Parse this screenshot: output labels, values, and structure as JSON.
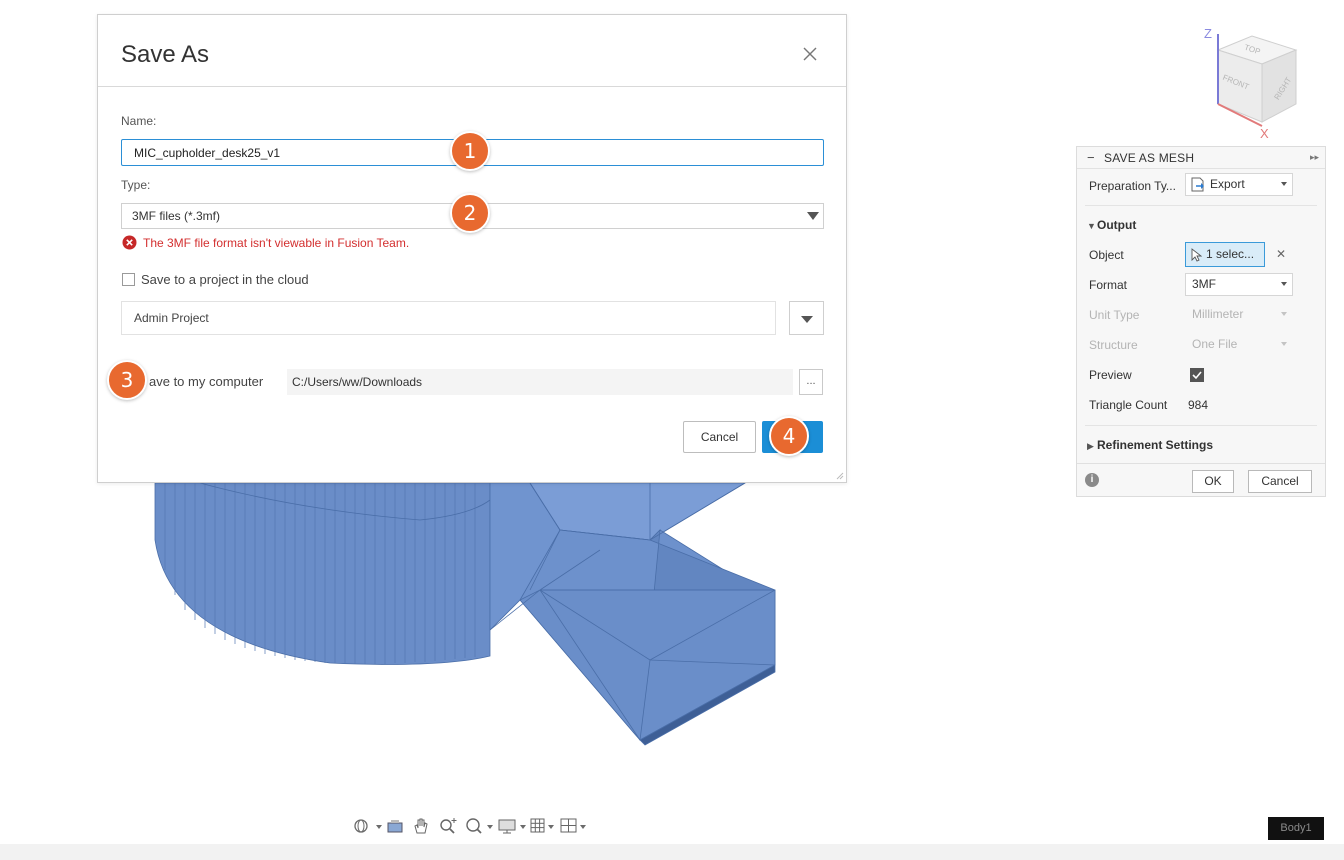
{
  "dialog": {
    "title": "Save As",
    "name_label": "Name:",
    "name_value": "MIC_cupholder_desk25_v1",
    "type_label": "Type:",
    "type_value": "3MF files (*.3mf)",
    "error_text": "The 3MF file format isn't viewable in Fusion Team.",
    "cloud_checkbox_label": "Save to a project in the cloud",
    "project_value": "Admin Project",
    "local_label": "ave to my computer",
    "path_value": "C:/Users/ww/Downloads",
    "browse_label": "...",
    "cancel_label": "Cancel",
    "save_label": ""
  },
  "steps": [
    "1",
    "2",
    "3",
    "4"
  ],
  "mesh_panel": {
    "title": "SAVE AS MESH",
    "preparation_label": "Preparation Ty...",
    "preparation_value": "Export",
    "output_section": "Output",
    "object_label": "Object",
    "object_value": "1 selec...",
    "format_label": "Format",
    "format_value": "3MF",
    "unit_type_label": "Unit Type",
    "unit_type_value": "Millimeter",
    "structure_label": "Structure",
    "structure_value": "One File",
    "preview_label": "Preview",
    "preview_checked": true,
    "triangle_count_label": "Triangle Count",
    "triangle_count_value": "984",
    "refinement_section": "Refinement Settings",
    "ok_label": "OK",
    "cancel_label": "Cancel"
  },
  "viewcube": {
    "top": "TOP",
    "front": "FRONT",
    "right": "RIGHT",
    "axis_z": "Z",
    "axis_x": "X"
  },
  "status": {
    "body_label": "Body1"
  },
  "colors": {
    "accent": "#1b8ed6",
    "step_marker": "#e8692f",
    "error": "#d32f2f",
    "mesh": "#6b8fc9"
  }
}
